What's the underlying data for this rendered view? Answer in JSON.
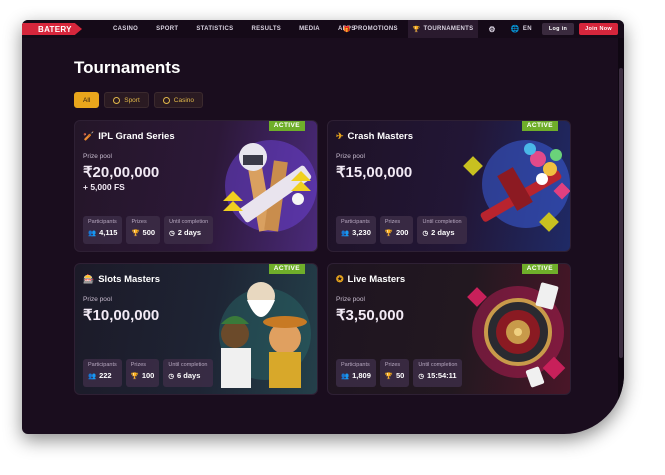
{
  "brand": {
    "logo_text": "BATERY"
  },
  "nav": {
    "items": [
      "CASINO",
      "SPORT",
      "STATISTICS",
      "RESULTS",
      "MEDIA",
      "APPS"
    ]
  },
  "right_nav": {
    "promotions": "PROMOTIONS",
    "tournaments": "TOURNAMENTS",
    "lang": "EN",
    "login": "Log in",
    "join": "Join Now"
  },
  "page": {
    "title": "Tournaments"
  },
  "filters": [
    {
      "label": "All",
      "active": true
    },
    {
      "label": "Sport",
      "icon": "soccer-ball-icon"
    },
    {
      "label": "Casino",
      "icon": "casino-chip-icon"
    }
  ],
  "labels": {
    "prize_pool": "Prize pool",
    "participants": "Participants",
    "prizes": "Prizes",
    "until": "Until completion",
    "active": "ACTIVE"
  },
  "cards": [
    {
      "name": "IPL Grand Series",
      "icon": "cricket-bat-icon",
      "prize": "₹20,00,000",
      "extra": "+ 5,000 FS",
      "participants": "4,115",
      "prizes": "500",
      "until": "2 days"
    },
    {
      "name": "Crash Masters",
      "icon": "plane-icon",
      "prize": "₹15,00,000",
      "extra": "",
      "participants": "3,230",
      "prizes": "200",
      "until": "2 days"
    },
    {
      "name": "Slots Masters",
      "icon": "slot-machine-icon",
      "prize": "₹10,00,000",
      "extra": "",
      "participants": "222",
      "prizes": "100",
      "until": "6 days"
    },
    {
      "name": "Live Masters",
      "icon": "roulette-icon",
      "prize": "₹3,50,000",
      "extra": "",
      "participants": "1,809",
      "prizes": "50",
      "until": "15:54:11"
    }
  ],
  "colors": {
    "accent": "#e8a51c",
    "brand": "#d6263c",
    "active_badge": "#6fae2a",
    "background": "#1a0d1e"
  }
}
